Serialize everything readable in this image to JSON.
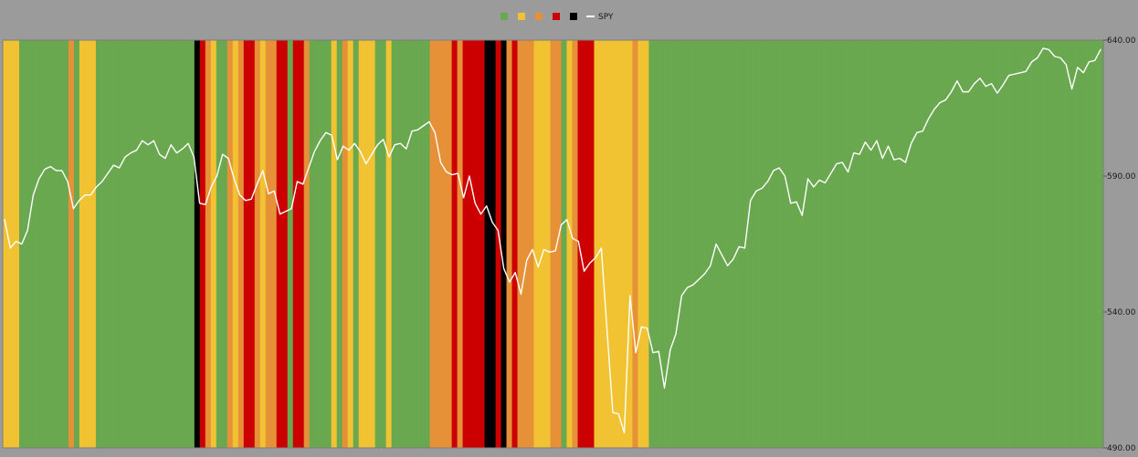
{
  "chart_data": {
    "type": "line",
    "colors": {
      "page_background": "#9b9b9b",
      "green": "#69a84f",
      "yellow": "#f1c232",
      "orange": "#e69138",
      "red": "#cc0000",
      "black": "#000000",
      "line": "#ffffff",
      "band_divider": "#7aa864"
    },
    "legend": {
      "placement": "top-center",
      "items": [
        {
          "label": "",
          "color": "#69a84f",
          "kind": "swatch"
        },
        {
          "label": "",
          "color": "#f1c232",
          "kind": "swatch"
        },
        {
          "label": "",
          "color": "#e69138",
          "kind": "swatch"
        },
        {
          "label": "",
          "color": "#cc0000",
          "kind": "swatch"
        },
        {
          "label": "",
          "color": "#000000",
          "kind": "swatch"
        },
        {
          "label": "SPY",
          "color": "#ffffff",
          "kind": "line"
        }
      ]
    },
    "y_axis": {
      "position": "right",
      "ylim": [
        490,
        640
      ],
      "ticks": [
        490,
        540,
        590,
        640
      ],
      "tick_labels": [
        "490.00",
        "540.00",
        "590.00",
        "640.00"
      ]
    },
    "band_count": 201,
    "band_colors": [
      "Y",
      "Y",
      "Y",
      "G",
      "G",
      "G",
      "G",
      "G",
      "G",
      "G",
      "G",
      "G",
      "O",
      "G",
      "Y",
      "Y",
      "Y",
      "G",
      "G",
      "G",
      "G",
      "G",
      "G",
      "G",
      "G",
      "G",
      "G",
      "G",
      "G",
      "G",
      "G",
      "G",
      "G",
      "G",
      "G",
      "B",
      "R",
      "O",
      "Y",
      "G",
      "G",
      "O",
      "Y",
      "O",
      "R",
      "R",
      "O",
      "Y",
      "O",
      "O",
      "R",
      "R",
      "G",
      "R",
      "R",
      "O",
      "G",
      "G",
      "G",
      "G",
      "Y",
      "G",
      "O",
      "Y",
      "G",
      "Y",
      "Y",
      "Y",
      "G",
      "G",
      "Y",
      "G",
      "G",
      "G",
      "G",
      "G",
      "G",
      "G",
      "O",
      "O",
      "O",
      "O",
      "R",
      "O",
      "R",
      "R",
      "R",
      "R",
      "B",
      "B",
      "R",
      "B",
      "O",
      "R",
      "O",
      "O",
      "O",
      "Y",
      "Y",
      "Y",
      "O",
      "O",
      "G",
      "Y",
      "O",
      "R",
      "R",
      "R",
      "Y",
      "Y",
      "Y",
      "Y",
      "Y",
      "Y",
      "Y",
      "O",
      "Y",
      "Y",
      "G",
      "G",
      "G",
      "G",
      "G",
      "G",
      "G",
      "G",
      "G",
      "G",
      "G",
      "G",
      "G",
      "G",
      "G",
      "G",
      "G",
      "G",
      "G",
      "G",
      "G",
      "G",
      "G",
      "G",
      "G",
      "G",
      "G",
      "G",
      "G",
      "G",
      "G",
      "G",
      "G",
      "G",
      "G",
      "G",
      "G",
      "G",
      "G",
      "G",
      "G",
      "G",
      "G",
      "G",
      "G",
      "G",
      "G",
      "G",
      "G",
      "G",
      "G",
      "G",
      "G",
      "G",
      "G",
      "G",
      "G",
      "G",
      "G",
      "G",
      "G",
      "G",
      "G",
      "G",
      "G",
      "G",
      "G",
      "G",
      "G",
      "G",
      "G",
      "G",
      "G",
      "G",
      "G",
      "G",
      "G",
      "G",
      "G",
      "G",
      "G",
      "G",
      "G"
    ],
    "series": [
      {
        "name": "SPY",
        "values": [
          574,
          563.5,
          566,
          565,
          570,
          583,
          589,
          592.5,
          593.5,
          592,
          592,
          588,
          578,
          581,
          583,
          583,
          586,
          588,
          591,
          594,
          593,
          597,
          598.5,
          599.5,
          603,
          601.5,
          603,
          598,
          596.5,
          601.5,
          598.5,
          600,
          602,
          597,
          580,
          579.5,
          586,
          590,
          598,
          596.5,
          589,
          583,
          581,
          581.5,
          587,
          592,
          583.5,
          584.5,
          576,
          577,
          578,
          588,
          587,
          593,
          599,
          603,
          606,
          605,
          596,
          601,
          599.5,
          602,
          599,
          594.5,
          598,
          601.5,
          603.5,
          597,
          601.5,
          602,
          600,
          606.5,
          607,
          608.5,
          610,
          606,
          595,
          591.5,
          590.5,
          591,
          582,
          590,
          580,
          576,
          579,
          573,
          570,
          556,
          551,
          554.5,
          546.5,
          559,
          563,
          556.5,
          563,
          562,
          562.5,
          572,
          574,
          567,
          566,
          555,
          558,
          560,
          563.5,
          533,
          503,
          502.5,
          495.5,
          546,
          525,
          534.5,
          534,
          525,
          525.5,
          512,
          526,
          532,
          546,
          549,
          550,
          552,
          554,
          557,
          565,
          561,
          557,
          559.5,
          564,
          563.5,
          581,
          584.5,
          585.5,
          588,
          592,
          593,
          590,
          580,
          580.5,
          575.5,
          589,
          586,
          588.5,
          587.5,
          591,
          594.5,
          595,
          591.5,
          598.5,
          598,
          602.5,
          599.5,
          603,
          596.5,
          601,
          596,
          596.5,
          595,
          602,
          606,
          606.5,
          611,
          614.5,
          617,
          618,
          621,
          625,
          621,
          621,
          624,
          626,
          623,
          624,
          620.5,
          623.5,
          627,
          627.5,
          628,
          628.5,
          632,
          633.5,
          637,
          636.5,
          634,
          633.5,
          631,
          622,
          630,
          628,
          632,
          632.5,
          636.5
        ]
      }
    ]
  }
}
